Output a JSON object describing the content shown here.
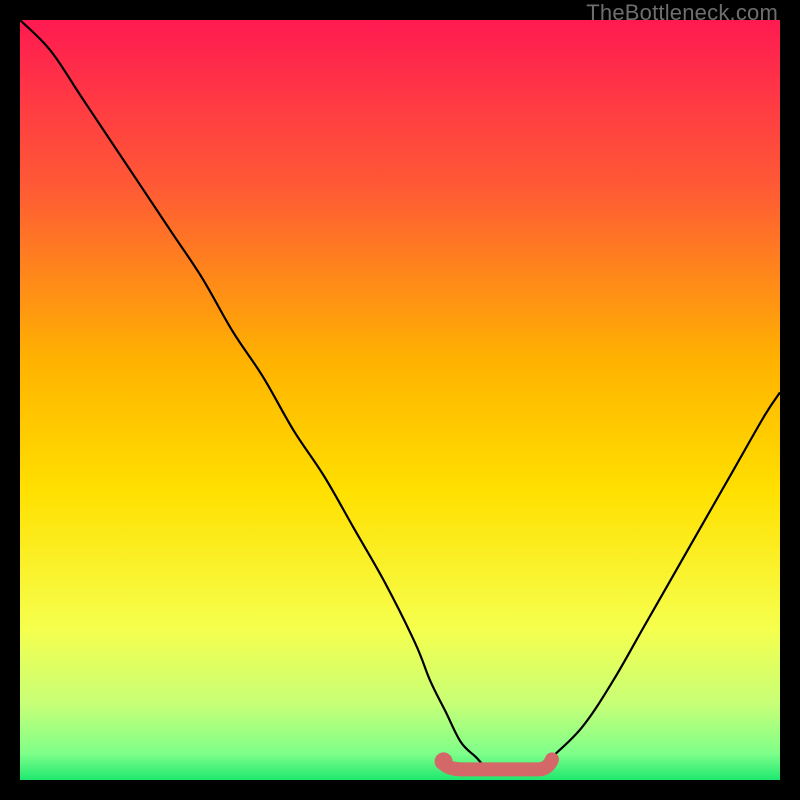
{
  "watermark": "TheBottleneck.com",
  "colors": {
    "top": "#ff1a51",
    "upper_mid": "#ff6a2e",
    "mid": "#ffd400",
    "lower_mid": "#f6ff4d",
    "near_bottom": "#c7ff77",
    "bottom": "#1ee86f",
    "curve": "#000000",
    "marker": "#d46868",
    "frame": "#000000"
  },
  "chart_data": {
    "type": "line",
    "title": "",
    "xlabel": "",
    "ylabel": "",
    "xlim": [
      0,
      100
    ],
    "ylim": [
      0,
      100
    ],
    "series": [
      {
        "name": "bottleneck-curve",
        "x": [
          0,
          4,
          8,
          12,
          16,
          20,
          24,
          28,
          32,
          36,
          40,
          44,
          48,
          52,
          54,
          56,
          58,
          60,
          62,
          64,
          66,
          68,
          70,
          74,
          78,
          82,
          86,
          90,
          94,
          98,
          100
        ],
        "y": [
          100,
          96,
          90,
          84,
          78,
          72,
          66,
          59,
          53,
          46,
          40,
          33,
          26,
          18,
          13,
          9,
          5,
          3,
          1,
          1,
          1,
          1,
          3,
          7,
          13,
          20,
          27,
          34,
          41,
          48,
          51
        ]
      }
    ],
    "markers": {
      "name": "highlight-range",
      "x_start": 56,
      "x_end": 70,
      "y": 1
    },
    "gradient_stops": [
      {
        "offset": 0.0,
        "color": "#ff1a51"
      },
      {
        "offset": 0.22,
        "color": "#ff5a35"
      },
      {
        "offset": 0.45,
        "color": "#ffb300"
      },
      {
        "offset": 0.62,
        "color": "#ffe000"
      },
      {
        "offset": 0.8,
        "color": "#f6ff4d"
      },
      {
        "offset": 0.9,
        "color": "#c7ff77"
      },
      {
        "offset": 0.965,
        "color": "#7fff8a"
      },
      {
        "offset": 1.0,
        "color": "#1ee86f"
      }
    ]
  }
}
